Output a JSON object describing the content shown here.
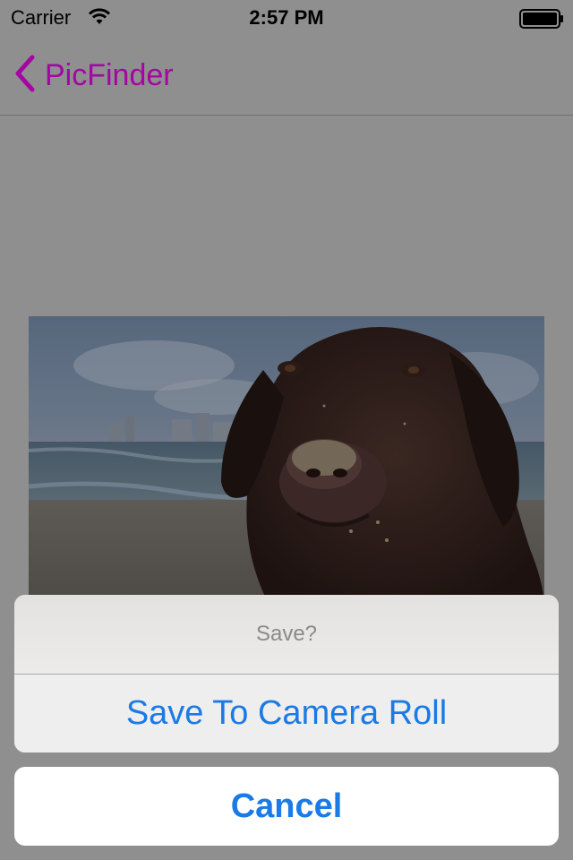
{
  "status_bar": {
    "carrier": "Carrier",
    "time": "2:57 PM"
  },
  "nav": {
    "back_label": "PicFinder"
  },
  "action_sheet": {
    "title": "Save?",
    "action_label": "Save To Camera Roll",
    "cancel_label": "Cancel"
  },
  "colors": {
    "tint": "#a406a4",
    "action_blue": "#1a7ae6",
    "dim_overlay": "#8f8f8f"
  },
  "icons": {
    "back": "chevron-left-icon",
    "wifi": "wifi-icon",
    "battery": "battery-icon"
  }
}
